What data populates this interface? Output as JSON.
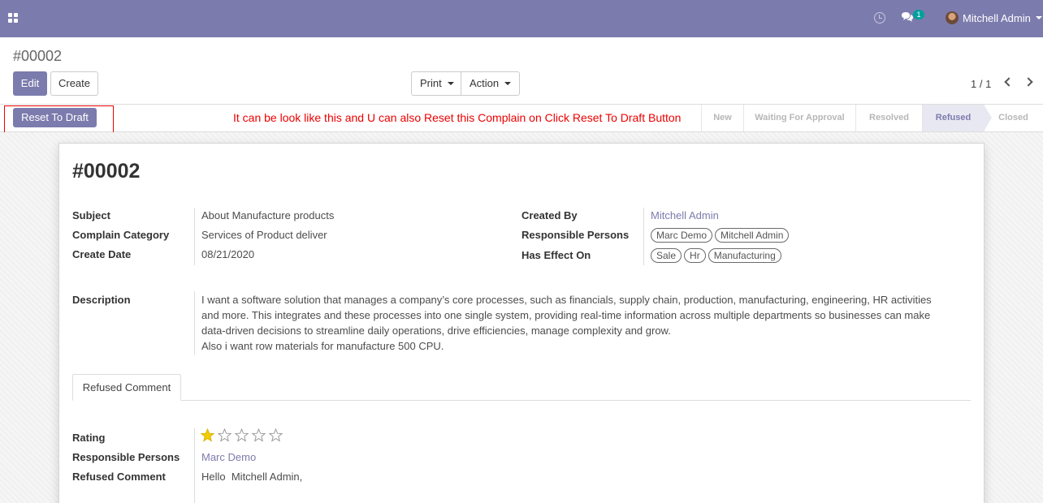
{
  "navbar": {
    "chat_count": "1",
    "user_name": "Mitchell Admin"
  },
  "control": {
    "breadcrumb": "#00002",
    "edit_label": "Edit",
    "create_label": "Create",
    "print_label": "Print",
    "action_label": "Action",
    "pager": "1 / 1"
  },
  "status": {
    "reset_label": "Reset To Draft",
    "annotation": "It can be look like this and U can also Reset this Complain on Click Reset To Draft Button",
    "stages": [
      "New",
      "Waiting For Approval",
      "Resolved",
      "Refused",
      "Closed"
    ],
    "active_stage": "Refused"
  },
  "record": {
    "title": "#00002",
    "left_fields": [
      {
        "label": "Subject",
        "value": "About Manufacture products"
      },
      {
        "label": "Complain Category",
        "value": "Services of Product deliver"
      },
      {
        "label": "Create Date",
        "value": "08/21/2020"
      }
    ],
    "created_by_label": "Created By",
    "created_by": "Mitchell Admin",
    "responsible_label": "Responsible Persons",
    "responsible_tags": [
      "Marc Demo",
      "Mitchell Admin"
    ],
    "effect_label": "Has Effect On",
    "effect_tags": [
      "Sale",
      "Hr",
      "Manufacturing"
    ],
    "description_label": "Description",
    "description_lines": [
      "I want a software solution that manages a company’s core processes, such as financials, supply chain, production, manufacturing, engineering, HR activities",
      "and more. This integrates and these processes into one single system, providing real-time information across multiple departments so businesses can make",
      "data-driven decisions to streamline daily operations, drive efficiencies, manage complexity and grow.",
      "Also i want row materials for manufacture 500 CPU."
    ]
  },
  "tab": {
    "label": "Refused Comment",
    "rating_label": "Rating",
    "rating": 1,
    "rating_max": 5,
    "responsible_label": "Responsible Persons",
    "responsible": "Marc Demo",
    "comment_label": "Refused Comment",
    "comment": "Hello  Mitchell Admin,"
  },
  "colors": {
    "brand": "#7c7bad",
    "annotation": "#ee0000",
    "star_filled": "#f3cc00"
  }
}
